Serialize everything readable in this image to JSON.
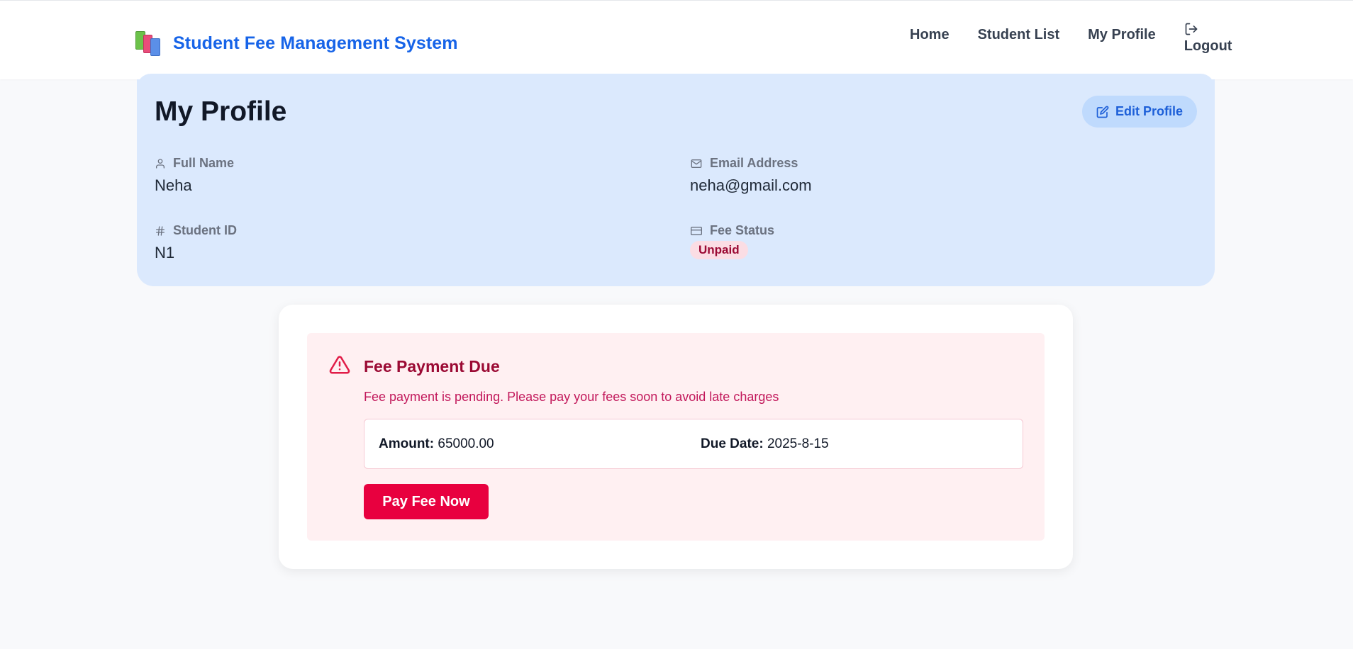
{
  "header": {
    "brand_title": "Student Fee Management System",
    "nav": {
      "home": "Home",
      "student_list": "Student List",
      "my_profile": "My Profile",
      "logout": "Logout"
    }
  },
  "profile": {
    "title": "My Profile",
    "edit_label": "Edit Profile",
    "fields": {
      "full_name_label": "Full Name",
      "full_name_value": "Neha",
      "email_label": "Email Address",
      "email_value": "neha@gmail.com",
      "student_id_label": "Student ID",
      "student_id_value": "N1",
      "fee_status_label": "Fee Status",
      "fee_status_value": "Unpaid"
    }
  },
  "fee_alert": {
    "title": "Fee Payment Due",
    "message": "Fee payment is pending. Please pay your fees soon to avoid late charges",
    "amount_label": "Amount:",
    "amount_value": "65000.00",
    "due_label": "Due Date:",
    "due_value": "2025-8-15",
    "pay_button": "Pay Fee Now"
  },
  "colors": {
    "brand": "#1764e8",
    "profile_bg": "#dbe9fd",
    "alert_bg": "#fff0f2",
    "danger": "#e8003f"
  }
}
